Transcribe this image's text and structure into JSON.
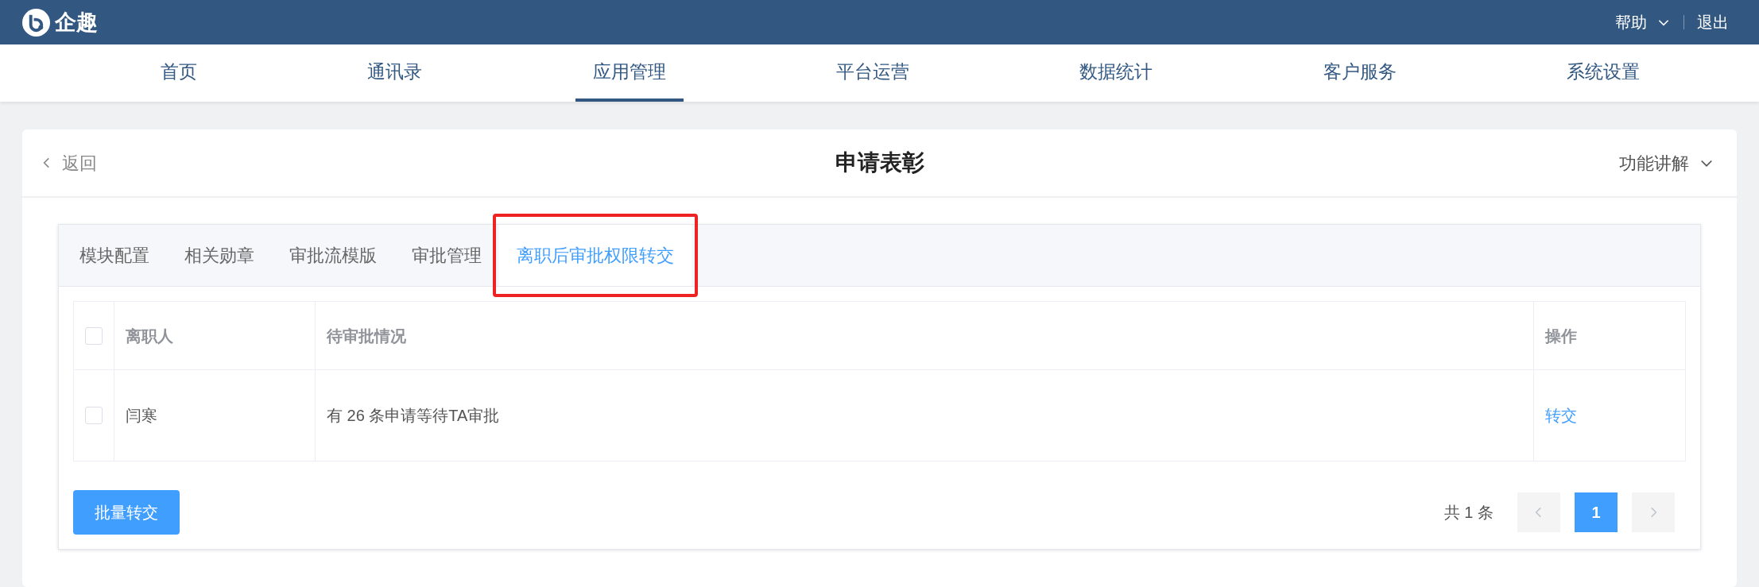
{
  "header": {
    "brand": "企趣",
    "links": [
      {
        "label": "帮助",
        "kind": "dropdown"
      },
      {
        "label": "退出",
        "kind": "link"
      }
    ]
  },
  "nav": [
    {
      "label": "首页",
      "selected": false
    },
    {
      "label": "通讯录",
      "selected": false
    },
    {
      "label": "应用管理",
      "selected": true
    },
    {
      "label": "平台运营",
      "selected": false
    },
    {
      "label": "数据统计",
      "selected": false
    },
    {
      "label": "客户服务",
      "selected": false
    },
    {
      "label": "系统设置",
      "selected": false
    }
  ],
  "card": {
    "back": "返回",
    "title": "申请表彰",
    "help": "功能讲解"
  },
  "tabs": [
    {
      "label": "模块配置",
      "selected": false,
      "highlighted": false
    },
    {
      "label": "相关勋章",
      "selected": false,
      "highlighted": false
    },
    {
      "label": "审批流模版",
      "selected": false,
      "highlighted": false
    },
    {
      "label": "审批管理",
      "selected": false,
      "highlighted": false
    },
    {
      "label": "离职后审批权限转交",
      "selected": true,
      "highlighted": true
    }
  ],
  "table": {
    "select_all_checked": false,
    "columns": [
      "离职人",
      "待审批情况",
      "操作"
    ],
    "rows": [
      {
        "checked": false,
        "person": "闫寒",
        "status": "有 26 条申请等待TA审批",
        "action": "转交"
      }
    ]
  },
  "bulk_button": "批量转交",
  "pagination": {
    "total": "共 1 条",
    "pages": [
      {
        "label": "1",
        "selected": true
      }
    ]
  }
}
